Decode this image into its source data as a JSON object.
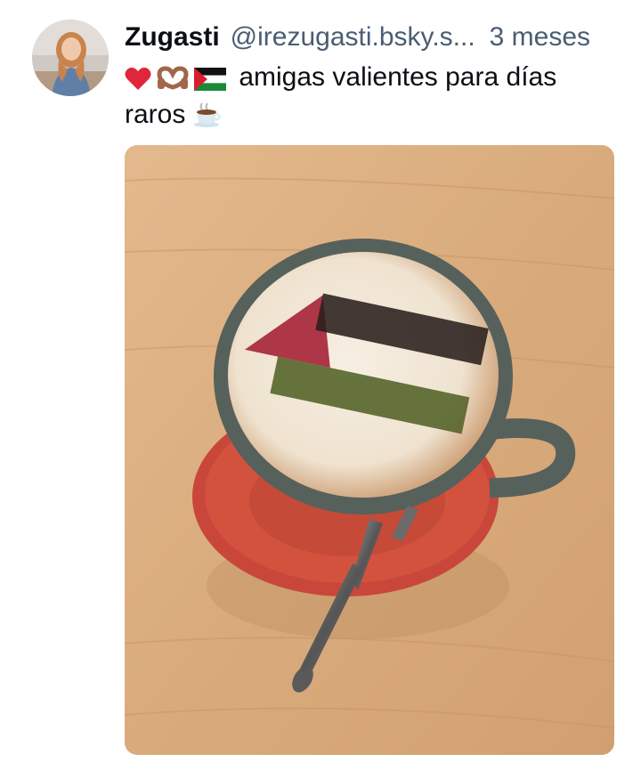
{
  "post": {
    "author": {
      "display_name": "Zugasti",
      "handle": "@irezugasti.bsky.s...",
      "avatar_icon": "profile-photo"
    },
    "timestamp": "3 meses",
    "text": {
      "emojis": [
        "red-heart-icon",
        "heart-hands-icon",
        "palestine-flag-icon"
      ],
      "line1": "amigas valientes para días",
      "line2": "raros",
      "trailing_emoji": "hot-beverage-icon"
    },
    "media": {
      "alt_subject": "cappuccino with Palestinian flag latte art",
      "colors": {
        "table": "#dcb083",
        "saucer": "#d2523d",
        "cup": "#56615c",
        "foam": "#f1e6d6",
        "flag_red": "#a52436",
        "flag_black": "#2a1f1c",
        "flag_green": "#55652a"
      }
    }
  }
}
